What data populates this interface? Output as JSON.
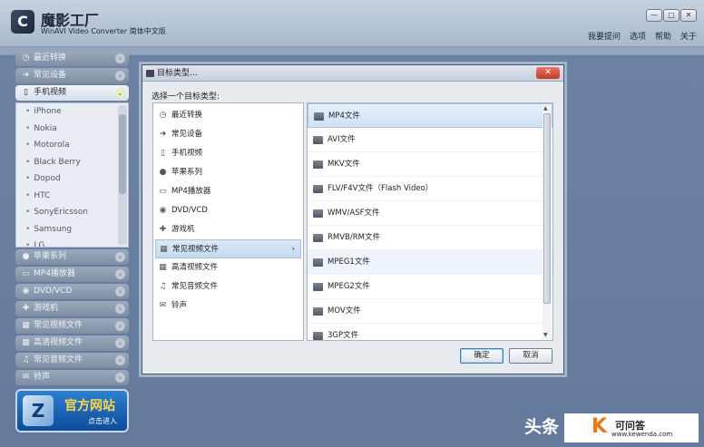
{
  "app": {
    "title": "魔影工厂",
    "subtitle": "WinAVI Video Converter 简体中文版",
    "logo_glyph": "C",
    "window_buttons": [
      "—",
      "□",
      "✕"
    ],
    "menu": [
      "我要提问",
      "选项",
      "帮助",
      "关于"
    ]
  },
  "sidebar": {
    "categories_top": [
      {
        "icon": "recent-icon",
        "glyph": "◷",
        "label": "最近转换"
      },
      {
        "icon": "device-icon",
        "glyph": "➜",
        "label": "常见设备"
      },
      {
        "icon": "phone-icon",
        "glyph": "▯",
        "label": "手机视频"
      }
    ],
    "devices": [
      "iPhone",
      "Nokia",
      "Motorola",
      "Black Berry",
      "Dopod",
      "HTC",
      "SonyEricsson",
      "Samsung",
      "LG"
    ],
    "categories_bottom": [
      {
        "icon": "apple-icon",
        "glyph": "●",
        "label": "苹果系列"
      },
      {
        "icon": "mp4-player-icon",
        "glyph": "▭",
        "label": "MP4播放器"
      },
      {
        "icon": "dvd-icon",
        "glyph": "◉",
        "label": "DVD/VCD"
      },
      {
        "icon": "gamepad-icon",
        "glyph": "✚",
        "label": "游戏机"
      },
      {
        "icon": "film-icon",
        "glyph": "▦",
        "label": "常见视频文件"
      },
      {
        "icon": "hd-film-icon",
        "glyph": "▦",
        "label": "高清视频文件"
      },
      {
        "icon": "music-icon",
        "glyph": "♫",
        "label": "常见音频文件"
      },
      {
        "icon": "ringtone-icon",
        "glyph": "✉",
        "label": "铃声"
      }
    ],
    "banner": {
      "title": "官方网站",
      "sub": "点击进入",
      "glyph": "Z"
    }
  },
  "dialog": {
    "title": "目标类型...",
    "close": "✕",
    "prompt": "选择一个目标类型:",
    "categories": [
      {
        "icon": "recent-icon",
        "glyph": "◷",
        "label": "最近转换"
      },
      {
        "icon": "device-icon",
        "glyph": "➜",
        "label": "常见设备"
      },
      {
        "icon": "phone-icon",
        "glyph": "▯",
        "label": "手机视频"
      },
      {
        "icon": "apple-icon",
        "glyph": "●",
        "label": "苹果系列"
      },
      {
        "icon": "mp4-player-icon",
        "glyph": "▭",
        "label": "MP4播放器"
      },
      {
        "icon": "dvd-icon",
        "glyph": "◉",
        "label": "DVD/VCD"
      },
      {
        "icon": "gamepad-icon",
        "glyph": "✚",
        "label": "游戏机"
      },
      {
        "icon": "film-icon",
        "glyph": "▦",
        "label": "常见视频文件"
      },
      {
        "icon": "hd-film-icon",
        "glyph": "▦",
        "label": "高清视频文件"
      },
      {
        "icon": "music-icon",
        "glyph": "♫",
        "label": "常见音频文件"
      },
      {
        "icon": "ringtone-icon",
        "glyph": "✉",
        "label": "铃声"
      }
    ],
    "selected_category": "常见视频文件",
    "formats": [
      "MP4文件",
      "AVI文件",
      "MKV文件",
      "FLV/F4V文件（Flash Video）",
      "WMV/ASF文件",
      "RMVB/RM文件",
      "MPEG1文件",
      "MPEG2文件",
      "MOV文件",
      "3GP文件"
    ],
    "selected_format": "MP4文件",
    "hover_format": "MPEG1文件",
    "ok": "确定",
    "cancel": "取消"
  },
  "watermark": {
    "left": "头条",
    "k": "K",
    "title": "可问答",
    "url": "www.kewenda.com"
  }
}
